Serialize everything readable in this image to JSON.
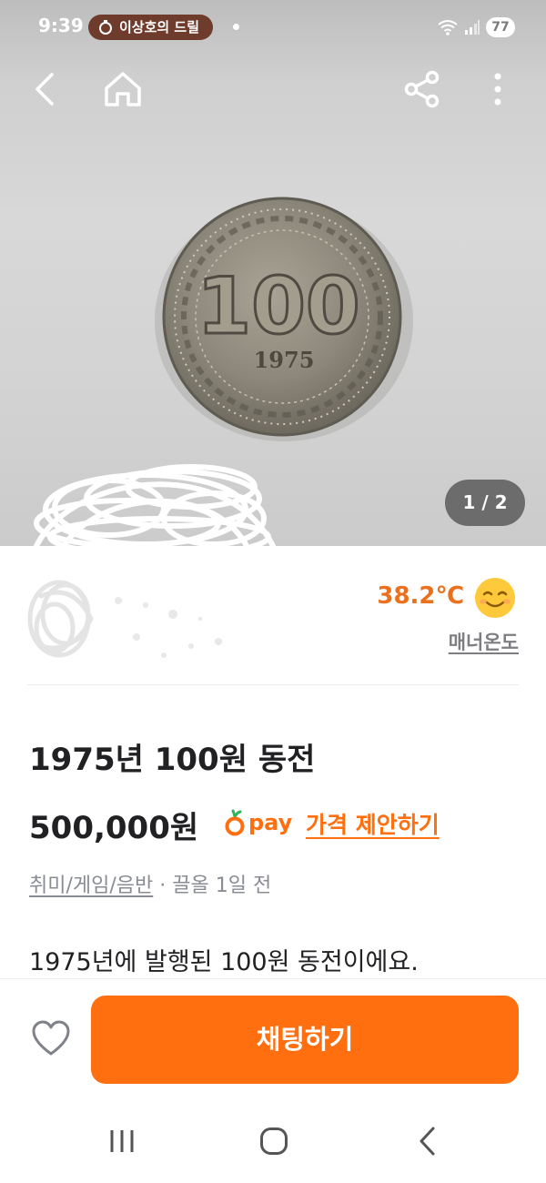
{
  "status_bar": {
    "time": "9:39",
    "notification_pill": "이상호의 드릴",
    "battery": "77"
  },
  "top_nav": {
    "back_icon": "chevron-left-icon",
    "home_icon": "home-icon",
    "share_icon": "share-icon",
    "more_icon": "more-vertical-icon"
  },
  "photo": {
    "page_counter": "1 / 2",
    "coin_value_text": "100",
    "coin_year_text": "1975"
  },
  "seller": {
    "manner_temperature": "38.2℃",
    "manner_label": "매너온도",
    "temperature_color": "#ec6f1c"
  },
  "product": {
    "title": "1975년 100원 동전",
    "price": "500,000원",
    "pay_label": "pay",
    "price_offer_link": "가격 제안하기",
    "category": "취미/게임/음반",
    "meta_separator": " · ",
    "posted_time": "끌올 1일 전",
    "description": "1975년에 발행된 100원 동전이에요."
  },
  "actions": {
    "like_icon": "heart-outline-icon",
    "chat_button": "채팅하기",
    "accent_color": "#ff6f0f"
  },
  "system_nav": {
    "recent_icon": "recent-apps-icon",
    "home_icon": "system-home-icon",
    "back_icon": "system-back-icon"
  }
}
